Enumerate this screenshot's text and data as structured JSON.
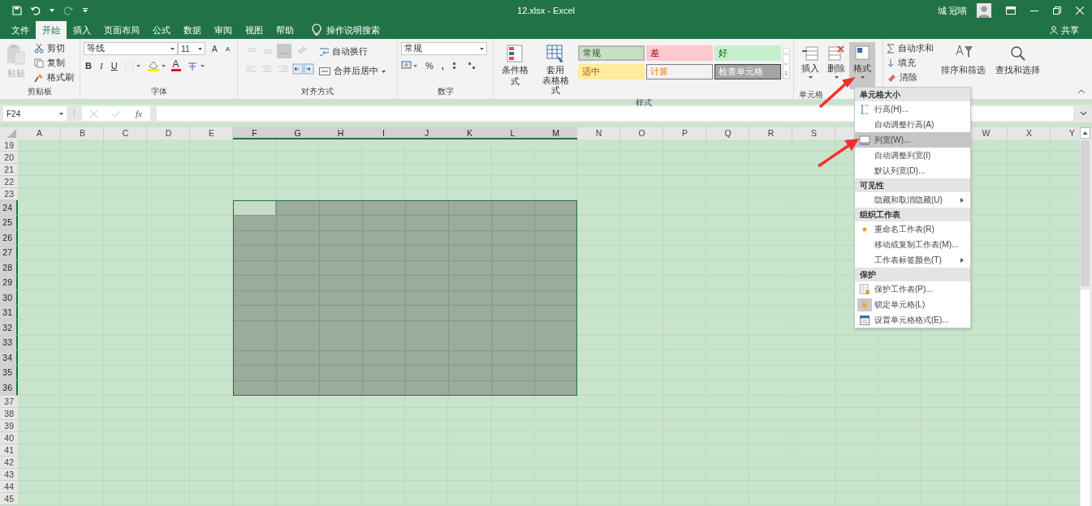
{
  "title_bar": {
    "title": "12.xlsx  -  Excel",
    "user": "城 冠喵"
  },
  "tabs": [
    {
      "label": "文件",
      "selected": false
    },
    {
      "label": "开始",
      "selected": true
    },
    {
      "label": "插入",
      "selected": false
    },
    {
      "label": "页面布局",
      "selected": false
    },
    {
      "label": "公式",
      "selected": false
    },
    {
      "label": "数据",
      "selected": false
    },
    {
      "label": "审阅",
      "selected": false
    },
    {
      "label": "视图",
      "selected": false
    },
    {
      "label": "帮助",
      "selected": false
    }
  ],
  "tell_me": "操作说明搜索",
  "share": "共享",
  "ribbon": {
    "clipboard": {
      "label": "剪贴板",
      "paste": "粘贴",
      "items": [
        "剪切",
        "复制",
        "格式刷"
      ]
    },
    "font": {
      "label": "字体",
      "name": "等线",
      "size": "11",
      "grow": "A",
      "shrink": "A",
      "styles": [
        "B",
        "I",
        "U"
      ],
      "color_glyph": "A"
    },
    "alignment": {
      "label": "对齐方式",
      "wrap": "自动换行",
      "merge": "合并后居中"
    },
    "number": {
      "label": "数字",
      "format": "常规",
      "percent": "%",
      "comma": ","
    },
    "styles": {
      "label": "样式",
      "conditional": "条件格式",
      "table": [
        "套用",
        "表格格式"
      ],
      "cells": [
        {
          "label": "常规",
          "kind": "normal",
          "selected": true
        },
        {
          "label": "差",
          "kind": "bad",
          "selected": false
        },
        {
          "label": "好",
          "kind": "good",
          "selected": false
        },
        {
          "label": "适中",
          "kind": "neutral",
          "selected": false
        },
        {
          "label": "计算",
          "kind": "calculation",
          "selected": false
        },
        {
          "label": "检查单元格",
          "kind": "check",
          "selected": false
        }
      ]
    },
    "cells": {
      "label": "单元格",
      "buttons": [
        {
          "label": "插入",
          "selected": false
        },
        {
          "label": "删除",
          "selected": false
        },
        {
          "label": "格式",
          "selected": true
        }
      ]
    },
    "editing": {
      "items": [
        "自动求和",
        "填充",
        "清除"
      ],
      "sort": "排序和筛选",
      "find": "查找和选择"
    }
  },
  "formula_bar": {
    "name_box": "F24",
    "fx": "fx"
  },
  "sheet": {
    "columns": [
      {
        "label": "A",
        "selected": false
      },
      {
        "label": "B",
        "selected": false
      },
      {
        "label": "C",
        "selected": false
      },
      {
        "label": "D",
        "selected": false
      },
      {
        "label": "E",
        "selected": false
      },
      {
        "label": "F",
        "selected": true
      },
      {
        "label": "G",
        "selected": true
      },
      {
        "label": "H",
        "selected": true
      },
      {
        "label": "I",
        "selected": true
      },
      {
        "label": "J",
        "selected": true
      },
      {
        "label": "K",
        "selected": true
      },
      {
        "label": "L",
        "selected": true
      },
      {
        "label": "M",
        "selected": true
      },
      {
        "label": "N",
        "selected": false
      },
      {
        "label": "O",
        "selected": false
      },
      {
        "label": "P",
        "selected": false
      },
      {
        "label": "Q",
        "selected": false
      },
      {
        "label": "R",
        "selected": false
      },
      {
        "label": "S",
        "selected": false
      },
      {
        "label": "W",
        "selected": false
      },
      {
        "label": "X",
        "selected": false
      },
      {
        "label": "Y",
        "selected": false
      }
    ],
    "rows": [
      {
        "label": "19",
        "selected": false
      },
      {
        "label": "20",
        "selected": false
      },
      {
        "label": "21",
        "selected": false
      },
      {
        "label": "22",
        "selected": false
      },
      {
        "label": "23",
        "selected": false
      },
      {
        "label": "24",
        "selected": true
      },
      {
        "label": "25",
        "selected": true
      },
      {
        "label": "26",
        "selected": true
      },
      {
        "label": "27",
        "selected": true
      },
      {
        "label": "28",
        "selected": true
      },
      {
        "label": "29",
        "selected": true
      },
      {
        "label": "30",
        "selected": true
      },
      {
        "label": "31",
        "selected": true
      },
      {
        "label": "32",
        "selected": true
      },
      {
        "label": "33",
        "selected": true
      },
      {
        "label": "34",
        "selected": true
      },
      {
        "label": "35",
        "selected": true
      },
      {
        "label": "36",
        "selected": true
      },
      {
        "label": "37",
        "selected": false
      },
      {
        "label": "38",
        "selected": false
      },
      {
        "label": "39",
        "selected": false
      },
      {
        "label": "40",
        "selected": false
      },
      {
        "label": "41",
        "selected": false
      },
      {
        "label": "42",
        "selected": false
      },
      {
        "label": "43",
        "selected": false
      },
      {
        "label": "44",
        "selected": false
      },
      {
        "label": "45",
        "selected": false
      }
    ]
  },
  "format_menu": {
    "sections": [
      {
        "header": "单元格大小",
        "items": [
          {
            "label": "行高(H)...",
            "kind": "row-height",
            "selected": false,
            "submenu": false
          },
          {
            "label": "自动调整行高(A)",
            "kind": "plain",
            "selected": false,
            "submenu": false
          },
          {
            "label": "列宽(W)...",
            "kind": "column-width",
            "selected": true,
            "submenu": false
          },
          {
            "label": "自动调整列宽(I)",
            "kind": "plain",
            "selected": false,
            "submenu": false
          },
          {
            "label": "默认列宽(D)...",
            "kind": "plain",
            "selected": false,
            "submenu": false
          }
        ]
      },
      {
        "header": "可见性",
        "items": [
          {
            "label": "隐藏和取消隐藏(U)",
            "kind": "plain",
            "selected": false,
            "submenu": true
          }
        ]
      },
      {
        "header": "组织工作表",
        "items": [
          {
            "label": "重命名工作表(R)",
            "kind": "bullet",
            "selected": false,
            "submenu": false
          },
          {
            "label": "移动或复制工作表(M)...",
            "kind": "plain",
            "selected": false,
            "submenu": false
          },
          {
            "label": "工作表标签颜色(T)",
            "kind": "plain",
            "selected": false,
            "submenu": true
          }
        ]
      },
      {
        "header": "保护",
        "items": [
          {
            "label": "保护工作表(P)...",
            "kind": "protect",
            "selected": false,
            "submenu": false
          },
          {
            "label": "锁定单元格(L)",
            "kind": "lock",
            "selected": false,
            "submenu": false
          },
          {
            "label": "设置单元格格式(E)...",
            "kind": "format-cells",
            "selected": false,
            "submenu": false
          }
        ]
      }
    ]
  }
}
